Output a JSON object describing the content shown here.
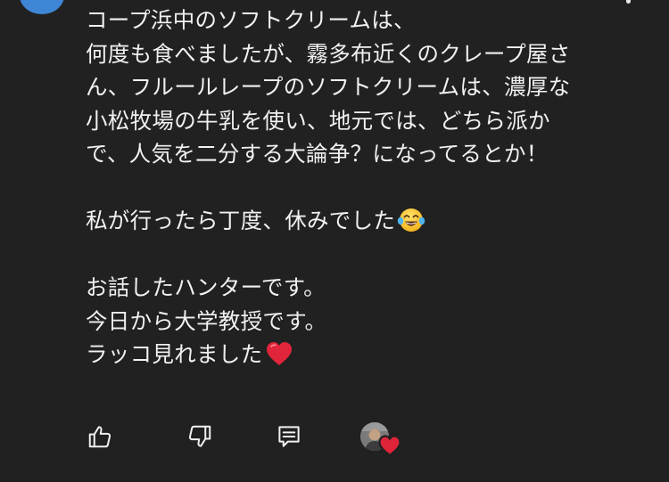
{
  "comment": {
    "lines": [
      "コープ浜中のソフトクリームは、",
      "何度も食べましたが、霧多布近くのクレープ屋さ",
      "ん、フルールレープのソフトクリームは、濃厚な",
      "小松牧場の牛乳を使い、地元では、どちら派か",
      "で、人気を二分する大論争？になってるとか！",
      "",
      "私が行ったら丁度、休みでした",
      "",
      "お話したハンターです。",
      "今日から大学教授です。",
      "ラッコ見れました"
    ],
    "emojis": {
      "line7": "laughing-tears-emoji",
      "line11": "red-heart-emoji"
    }
  },
  "actions": {
    "like_icon": "thumbs-up-icon",
    "dislike_icon": "thumbs-down-icon",
    "reply_icon": "reply-icon",
    "creator_heart_icon": "creator-heart-icon"
  },
  "colors": {
    "background": "#212121",
    "text": "#f1f1f1",
    "avatar": "#3f86d6",
    "heart": "#e0243a"
  }
}
